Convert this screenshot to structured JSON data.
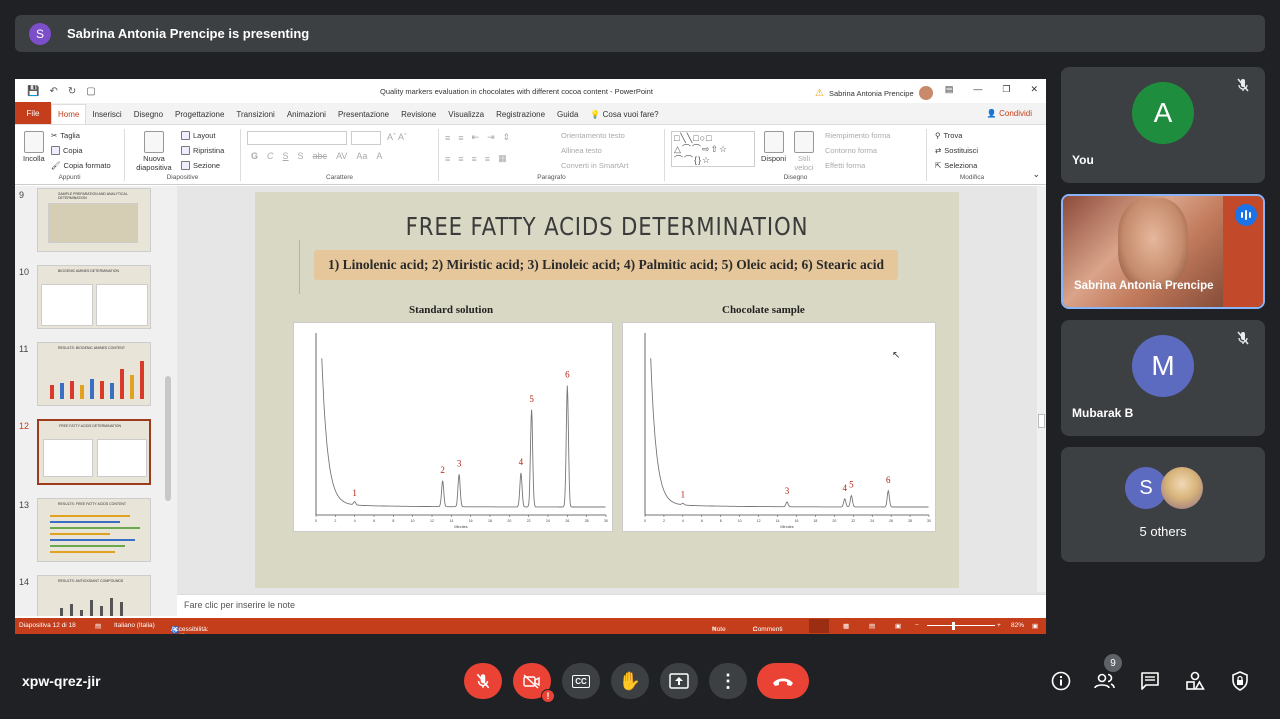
{
  "banner": {
    "avatar_letter": "S",
    "text": "Sabrina Antonia Prencipe is presenting"
  },
  "ppt": {
    "window_title": "Quality markers evaluation in chocolates with different cocoa content  -  PowerPoint",
    "user_name": "Sabrina Antonia Prencipe",
    "tabs": [
      "File",
      "Home",
      "Inserisci",
      "Disegno",
      "Progettazione",
      "Transizioni",
      "Animazioni",
      "Presentazione",
      "Revisione",
      "Visualizza",
      "Registrazione",
      "Guida"
    ],
    "active_tab": "Home",
    "tell_me": "Cosa vuoi fare?",
    "share": "Condividi",
    "ribbon": {
      "appunti": {
        "incolla": "Incolla",
        "taglia": "Taglia",
        "copia": "Copia",
        "copia_formato": "Copia formato",
        "label": "Appunti"
      },
      "diapositive": {
        "nuova": "Nuova diapositiva",
        "layout": "Layout",
        "ripristina": "Ripristina",
        "sezione": "Sezione",
        "label": "Diapositive"
      },
      "carattere": {
        "label": "Carattere"
      },
      "paragrafo": {
        "orientamento": "Orientamento testo",
        "allinea": "Allinea testo",
        "converti": "Converti in SmartArt",
        "label": "Paragrafo"
      },
      "disegno": {
        "disponi": "Disponi",
        "stili": "Stili veloci",
        "riempimento": "Riempimento forma",
        "contorno": "Contorno forma",
        "effetti": "Effetti forma",
        "label": "Disegno"
      },
      "modifica": {
        "trova": "Trova",
        "sostituisci": "Sostituisci",
        "seleziona": "Seleziona",
        "label": "Modifica"
      }
    },
    "thumbnails": [
      {
        "num": "9",
        "title": "SAMPLE PREPARATION AND ANALYTICAL DETERMINATION"
      },
      {
        "num": "10",
        "title": "BIOGENIC AMINES DETERMINATION"
      },
      {
        "num": "11",
        "title": "RESULTS: BIOGENIC AMINES CONTENT"
      },
      {
        "num": "12",
        "title": "FREE FATTY ACIDS DETERMINATION"
      },
      {
        "num": "13",
        "title": "RESULTS: FREE FATTY ACIDS CONTENT"
      },
      {
        "num": "14",
        "title": "RESULTS: ANTIOXIDANT COMPOUNDS"
      }
    ],
    "slide": {
      "title": "FREE FATTY ACIDS DETERMINATION",
      "acids": "1) Linolenic acid; 2) Miristic acid; 3) Linoleic acid; 4) Palmitic acid; 5) Oleic acid; 6) Stearic acid",
      "left_label": "Standard solution",
      "right_label": "Chocolate sample"
    },
    "chart_data": [
      {
        "type": "line",
        "title": "Standard solution",
        "xlabel": "Minutes",
        "ylabel": "",
        "xlim": [
          0,
          30
        ],
        "peaks": [
          {
            "label": "1",
            "x": 4.0,
            "height": 0.02
          },
          {
            "label": "2",
            "x": 13.1,
            "height": 0.16
          },
          {
            "label": "3",
            "x": 14.8,
            "height": 0.2
          },
          {
            "label": "4",
            "x": 21.2,
            "height": 0.21
          },
          {
            "label": "5",
            "x": 22.3,
            "height": 0.6
          },
          {
            "label": "6",
            "x": 26.0,
            "height": 0.75
          }
        ]
      },
      {
        "type": "line",
        "title": "Chocolate sample",
        "xlabel": "Minutes",
        "ylabel": "",
        "xlim": [
          0,
          30
        ],
        "peaks": [
          {
            "label": "1",
            "x": 4.0,
            "height": 0.01
          },
          {
            "label": "3",
            "x": 15.0,
            "height": 0.03
          },
          {
            "label": "4",
            "x": 21.1,
            "height": 0.05
          },
          {
            "label": "5",
            "x": 21.8,
            "height": 0.07
          },
          {
            "label": "6",
            "x": 25.7,
            "height": 0.1
          }
        ]
      }
    ],
    "notes_placeholder": "Fare clic per inserire le note",
    "status": {
      "slide": "Diapositiva 12 di 18",
      "language": "Italiano (Italia)",
      "accessibility": "Accessibilità: verifica",
      "notes": "Note",
      "comments": "Commenti",
      "zoom": "82%"
    }
  },
  "participants": [
    {
      "name": "You",
      "letter": "A",
      "color": "#1e8e3e",
      "muted": true
    },
    {
      "name": "Sabrina Antonia Prencipe",
      "video": true,
      "speaking": true
    },
    {
      "name": "Mubarak B",
      "letter": "M",
      "color": "#5c6bc0",
      "muted": true
    },
    {
      "name": "5 others",
      "letter": "S",
      "color": "#5c6bc0"
    }
  ],
  "meeting_code": "xpw-qrez-jir",
  "participant_count": "9",
  "colors": {
    "end_call": "#ea4335",
    "bg": "#202124",
    "tile": "#3c4043",
    "ppt_accent": "#c43e1c"
  }
}
